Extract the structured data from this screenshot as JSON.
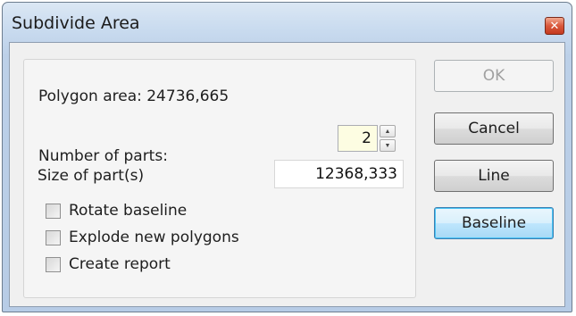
{
  "window": {
    "title": "Subdivide Area",
    "close_glyph": "✕"
  },
  "form": {
    "polygon_area_label": "Polygon area: 24736,665",
    "number_of_parts_label": "Number of parts:",
    "number_of_parts_value": "2",
    "size_of_parts_label": "Size of part(s)",
    "size_of_parts_value": "12368,333",
    "checkboxes": [
      {
        "label": "Rotate baseline",
        "checked": false
      },
      {
        "label": "Explode new polygons",
        "checked": false
      },
      {
        "label": "Create report",
        "checked": false
      }
    ]
  },
  "buttons": {
    "ok": "OK",
    "cancel": "Cancel",
    "line": "Line",
    "baseline": "Baseline"
  },
  "icons": {
    "close": "close-icon",
    "spin_up": "spin-up-icon",
    "spin_down": "spin-down-icon"
  },
  "colors": {
    "parts_input_bg": "#fdfde2",
    "default_button_border": "#3c7fb1",
    "close_button": "#c43a1f"
  }
}
